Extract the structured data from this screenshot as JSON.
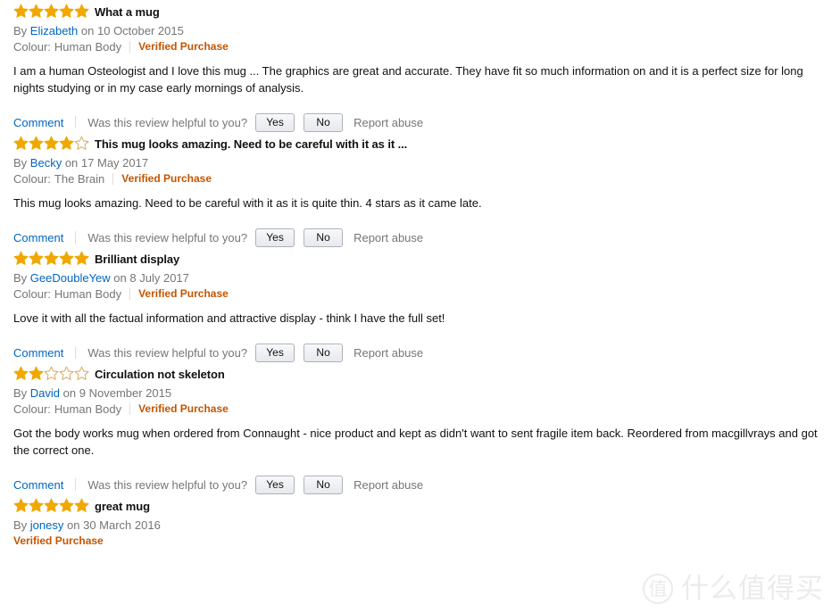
{
  "labels": {
    "by_prefix": "By",
    "on_prefix": "on",
    "colour_prefix": "Colour:",
    "verified_purchase": "Verified Purchase",
    "comment": "Comment",
    "helpful_question": "Was this review helpful to you?",
    "yes": "Yes",
    "no": "No",
    "report_abuse": "Report abuse"
  },
  "colors": {
    "star_filled": "#f0a800",
    "star_empty_outline": "#d9ae67",
    "link": "#0066c0",
    "verified": "#c45500",
    "muted_text": "#767676",
    "body_text": "#111111",
    "button_border": "#adb1b8"
  },
  "watermark": {
    "logo_char": "值",
    "text": "什么值得买"
  },
  "reviews": [
    {
      "rating": 5,
      "max_rating": 5,
      "title": "What a mug",
      "author": "Elizabeth",
      "date": "10 October 2015",
      "colour": "Human Body",
      "verified": true,
      "body": "I am a human Osteologist and I love this mug ... The graphics are great and accurate. They have fit so much information on and it is a perfect size for long nights studying or in my case early mornings of analysis.",
      "show_actions": true
    },
    {
      "rating": 4,
      "max_rating": 5,
      "title": "This mug looks amazing. Need to be careful with it as it ...",
      "author": "Becky",
      "date": "17 May 2017",
      "colour": "The Brain",
      "verified": true,
      "body": "This mug looks amazing. Need to be careful with it as it is quite thin. 4 stars as it came late.",
      "show_actions": true
    },
    {
      "rating": 5,
      "max_rating": 5,
      "title": "Brilliant display",
      "author": "GeeDoubleYew",
      "date": "8 July 2017",
      "colour": "Human Body",
      "verified": true,
      "body": "Love it with all the factual information and attractive display - think I have the full set!",
      "show_actions": true
    },
    {
      "rating": 2,
      "max_rating": 5,
      "title": "Circulation not skeleton",
      "author": "David",
      "date": "9 November 2015",
      "colour": "Human Body",
      "verified": true,
      "body": "Got the body works mug when ordered from Connaught - nice product and kept as didn't want to sent fragile item back. Reordered from macgillvrays and got the correct one.",
      "show_actions": true
    },
    {
      "rating": 5,
      "max_rating": 5,
      "title": "great mug",
      "author": "jonesy",
      "date": "30 March 2016",
      "colour": null,
      "verified": true,
      "body": null,
      "show_actions": false
    }
  ]
}
